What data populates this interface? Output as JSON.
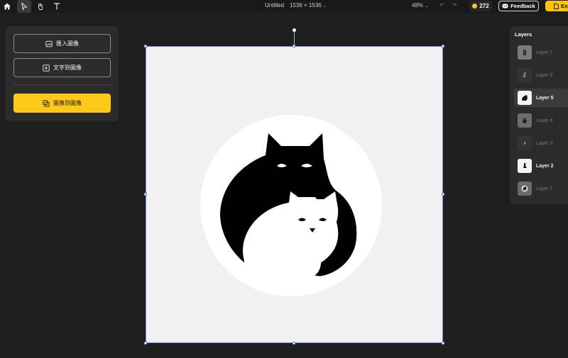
{
  "toolbar": {
    "tools": [
      {
        "name": "home",
        "icon": "home-icon"
      },
      {
        "name": "select",
        "icon": "pointer-icon",
        "active": true
      },
      {
        "name": "pan",
        "icon": "hand-icon"
      },
      {
        "name": "text",
        "icon": "text-icon"
      }
    ],
    "doc_title": "Untitled",
    "canvas_size": "1536 × 1536",
    "zoom": "48%",
    "credits": "272",
    "feedback_label": "Feedback",
    "export_label": "Exp"
  },
  "left_panel": {
    "import_label": "匯入圖像",
    "text_to_image_label": "文字到圖像",
    "image_to_image_label": "圖像到圖像"
  },
  "layers": {
    "title": "Layers",
    "items": [
      {
        "label": "Layer 7",
        "state": "dim",
        "selected": false
      },
      {
        "label": "Layer 6",
        "state": "dim",
        "selected": false
      },
      {
        "label": "Layer 5",
        "state": "bright",
        "selected": true
      },
      {
        "label": "Layer 4",
        "state": "dim",
        "selected": false
      },
      {
        "label": "Layer 3",
        "state": "dim",
        "selected": false
      },
      {
        "label": "Layer 2",
        "state": "bright",
        "selected": false
      },
      {
        "label": "Layer 1",
        "state": "dim",
        "selected": false
      }
    ]
  },
  "colors": {
    "accent": "#ffc918",
    "selection": "#6d8fd8",
    "canvas_bg": "#f1f1f2"
  }
}
